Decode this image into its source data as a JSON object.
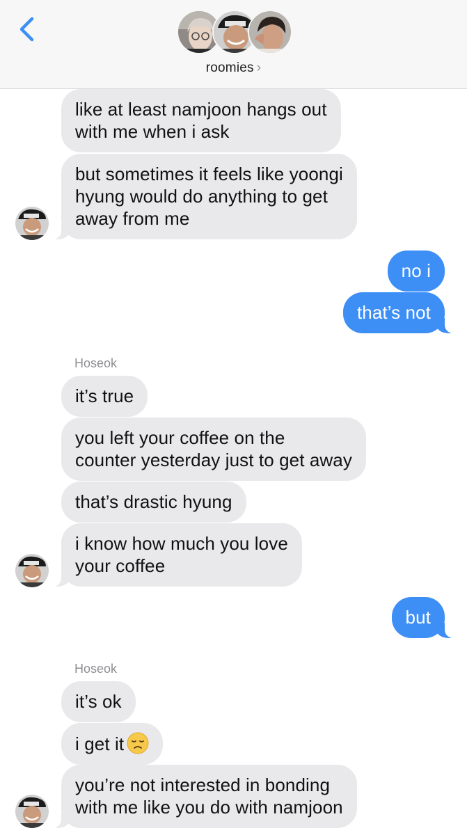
{
  "header": {
    "group_name": "roomies",
    "chevron": "›",
    "back_icon": "chevron-left-icon",
    "accent": "#3d8ff6"
  },
  "messages": [
    {
      "side": "incoming",
      "text": "like at least namjoon hangs out\nwith me when i ask"
    },
    {
      "side": "incoming",
      "text": "but sometimes it feels like yoongi\nhyung would do anything to get\naway from me"
    },
    {
      "side": "outgoing",
      "text": "no i"
    },
    {
      "side": "outgoing",
      "text": "that’s not"
    },
    {
      "side": "incoming",
      "sender": "Hoseok",
      "text": "it’s true"
    },
    {
      "side": "incoming",
      "text": "you left your coffee on the\ncounter yesterday just to get away"
    },
    {
      "side": "incoming",
      "text": "that’s drastic hyung"
    },
    {
      "side": "incoming",
      "text": "i know how much you love\nyour coffee"
    },
    {
      "side": "outgoing",
      "text": "but"
    },
    {
      "side": "incoming",
      "sender": "Hoseok",
      "text": "it’s ok"
    },
    {
      "side": "incoming",
      "text": "i get it",
      "emoji": "disappointed-face"
    },
    {
      "side": "incoming",
      "text": "you’re not interested in bonding\nwith me like you do with namjoon"
    }
  ],
  "colors": {
    "incoming_bubble": "#e9e9eb",
    "outgoing_bubble": "#3d8ff6"
  }
}
